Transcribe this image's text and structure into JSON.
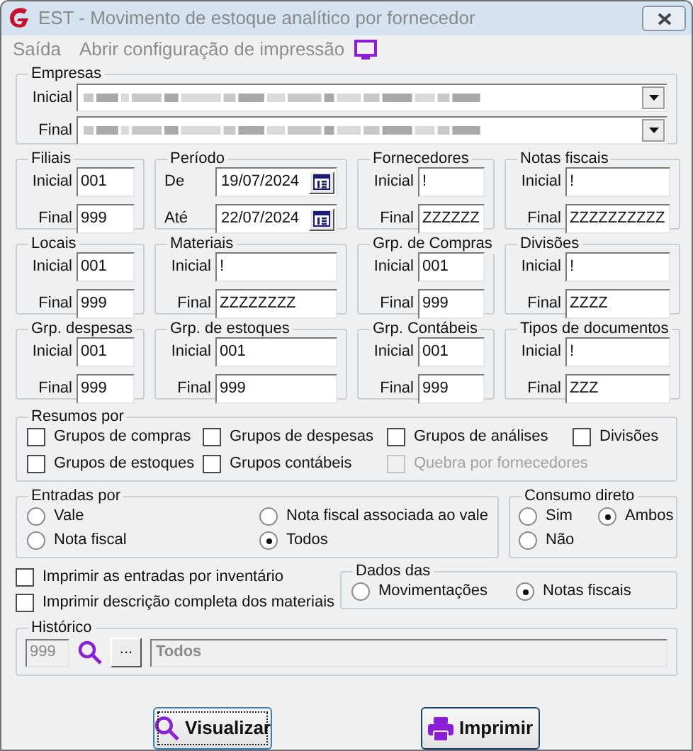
{
  "window": {
    "title": "EST - Movimento de estoque analítico por fornecedor"
  },
  "menu": [
    {
      "label": "Saída",
      "disabled": true
    },
    {
      "label": "Abrir configuração de impressão",
      "disabled": true
    }
  ],
  "empresas": {
    "title": "Empresas",
    "rows": [
      {
        "label": "Inicial"
      },
      {
        "label": "Final"
      }
    ]
  },
  "range_groups": [
    {
      "title": "Filiais",
      "rows": [
        {
          "label": "Inicial",
          "value": "001"
        },
        {
          "label": "Final",
          "value": "999"
        }
      ]
    },
    {
      "title": "Período",
      "kind": "date",
      "rows": [
        {
          "label": "De",
          "value": "19/07/2024"
        },
        {
          "label": "Até",
          "value": "22/07/2024"
        }
      ]
    },
    {
      "title": "Fornecedores",
      "rows": [
        {
          "label": "Inicial",
          "value": "!"
        },
        {
          "label": "Final",
          "value": "ZZZZZZ"
        }
      ]
    },
    {
      "title": "Notas fiscais",
      "rows": [
        {
          "label": "Inicial",
          "value": "!"
        },
        {
          "label": "Final",
          "value": "ZZZZZZZZZZ"
        }
      ]
    },
    {
      "title": "Locais",
      "rows": [
        {
          "label": "Inicial",
          "value": "001"
        },
        {
          "label": "Final",
          "value": "999"
        }
      ]
    },
    {
      "title": "Materiais",
      "rows": [
        {
          "label": "Inicial",
          "value": "!"
        },
        {
          "label": "Final",
          "value": "ZZZZZZZZ"
        }
      ]
    },
    {
      "title": "Grp. de Compras",
      "rows": [
        {
          "label": "Inicial",
          "value": "001"
        },
        {
          "label": "Final",
          "value": "999"
        }
      ]
    },
    {
      "title": "Divisões",
      "rows": [
        {
          "label": "Inicial",
          "value": "!"
        },
        {
          "label": "Final",
          "value": "ZZZZ"
        }
      ]
    },
    {
      "title": "Grp. despesas",
      "rows": [
        {
          "label": "Inicial",
          "value": "001"
        },
        {
          "label": "Final",
          "value": "999"
        }
      ]
    },
    {
      "title": "Grp. de estoques",
      "rows": [
        {
          "label": "Inicial",
          "value": "001"
        },
        {
          "label": "Final",
          "value": "999"
        }
      ]
    },
    {
      "title": "Grp. Contábeis",
      "rows": [
        {
          "label": "Inicial",
          "value": "001"
        },
        {
          "label": "Final",
          "value": "999"
        }
      ]
    },
    {
      "title": "Tipos de documentos",
      "rows": [
        {
          "label": "Inicial",
          "value": "!"
        },
        {
          "label": "Final",
          "value": "ZZZ"
        }
      ]
    }
  ],
  "resumos": {
    "title": "Resumos por",
    "options": [
      {
        "label": "Grupos de compras",
        "checked": false,
        "disabled": false
      },
      {
        "label": "Grupos de despesas",
        "checked": false,
        "disabled": false
      },
      {
        "label": "Grupos de análises",
        "checked": false,
        "disabled": false
      },
      {
        "label": "Divisões",
        "checked": false,
        "disabled": false
      },
      {
        "label": "Grupos de estoques",
        "checked": false,
        "disabled": false
      },
      {
        "label": "Grupos contábeis",
        "checked": false,
        "disabled": false
      },
      {
        "label": "Quebra por fornecedores",
        "checked": false,
        "disabled": true
      }
    ]
  },
  "entradas": {
    "title": "Entradas por",
    "options": [
      {
        "label": "Vale",
        "selected": false
      },
      {
        "label": "Nota fiscal associada ao vale",
        "selected": false
      },
      {
        "label": "Nota fiscal",
        "selected": false
      },
      {
        "label": "Todos",
        "selected": true
      }
    ]
  },
  "consumo": {
    "title": "Consumo direto",
    "options": [
      {
        "label": "Sim",
        "selected": false
      },
      {
        "label": "Ambos",
        "selected": true
      },
      {
        "label": "Não",
        "selected": false
      }
    ]
  },
  "print_options": [
    {
      "label": "Imprimir as entradas por inventário",
      "checked": false
    },
    {
      "label": "Imprimir descrição completa dos materiais",
      "checked": false
    }
  ],
  "dados": {
    "title": "Dados das",
    "options": [
      {
        "label": "Movimentações",
        "selected": false
      },
      {
        "label": "Notas fiscais",
        "selected": true
      }
    ]
  },
  "historico": {
    "title": "Histórico",
    "code": "999",
    "browse": "...",
    "description": "Todos"
  },
  "buttons": [
    {
      "label": "Visualizar",
      "kind": "preview",
      "default": true
    },
    {
      "label": "Imprimir",
      "kind": "print",
      "default": false
    }
  ]
}
